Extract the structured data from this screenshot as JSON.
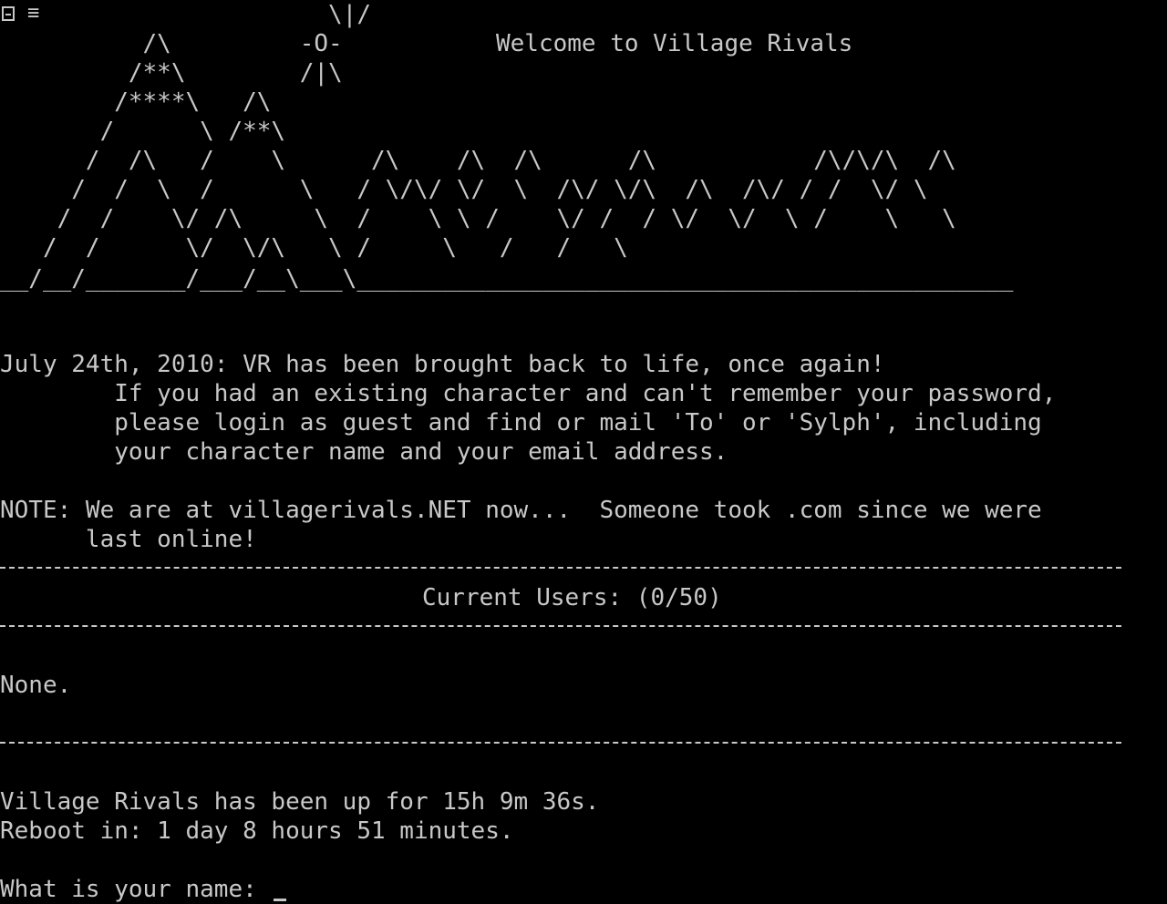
{
  "window": {
    "icons": [
      "terminal-menu-icon",
      "hamburger-icon"
    ]
  },
  "art": {
    "lines": [
      "                       \\|/",
      "          /\\         -O-",
      "         /**\\        /|\\",
      "        /****\\   /\\",
      "       /      \\ /**\\",
      "      /  /\\   /    \\      /\\    /\\  /\\      /\\           /\\/\\/\\  /\\",
      "     /  /  \\  /      \\   / \\/\\/ \\/  \\  /\\/ \\/\\  /\\  /\\/ / /  \\/ \\",
      "    /  /    \\/ /\\     \\  /    \\ \\ /    \\/ /  / \\/  \\/  \\ /    \\   \\",
      "   /  /      \\/  \\/\\   \\ /     \\   /   /   \\",
      "__/__/_______/___/__\\___\\______________________________________________"
    ],
    "title": "Welcome to Village Rivals"
  },
  "news": {
    "line1": "July 24th, 2010: VR has been brought back to life, once again!",
    "line2": "        If you had an existing character and can't remember your password,",
    "line3": "        please login as guest and find or mail 'To' or 'Sylph', including",
    "line4": "        your character name and your email address."
  },
  "note": {
    "line1": "NOTE: We are at villagerivals.NET now...  Someone took .com since we were",
    "line2": "      last online!"
  },
  "users": {
    "header": "Current Users: (0/50)",
    "list": "None."
  },
  "status": {
    "uptime": "Village Rivals has been up for 15h 9m 36s.",
    "reboot": "Reboot in: 1 day 8 hours 51 minutes."
  },
  "prompt": {
    "label": "What is your name:",
    "value": ""
  }
}
